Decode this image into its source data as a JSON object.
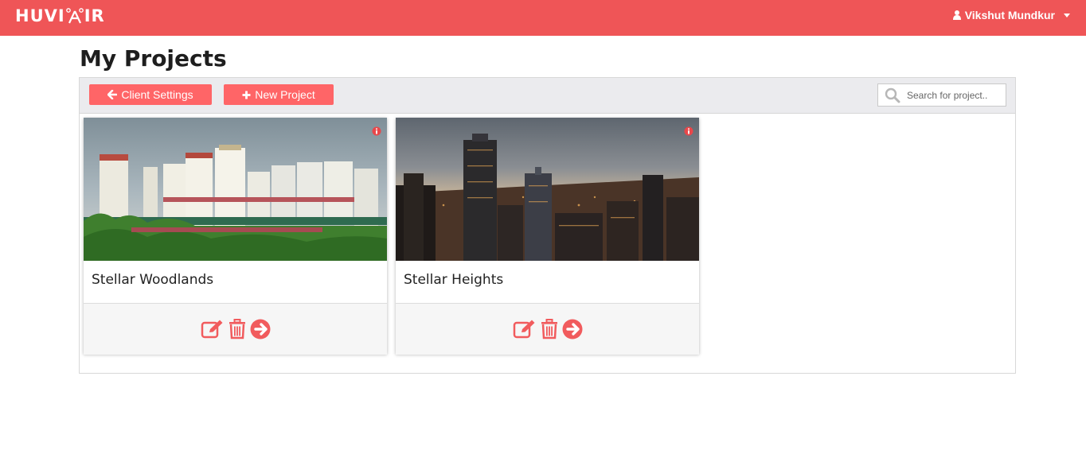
{
  "header": {
    "logo_text": "HUVIAIR",
    "user_name": "Vikshut Mundkur"
  },
  "page": {
    "title": "My Projects"
  },
  "toolbar": {
    "client_settings_label": "Client Settings",
    "new_project_label": "New Project",
    "search_placeholder": "Search for project.."
  },
  "projects": [
    {
      "name": "Stellar Woodlands"
    },
    {
      "name": "Stellar Heights"
    }
  ],
  "colors": {
    "brand": "#ef5557",
    "button": "#ff6567",
    "icon": "#f15b5d"
  },
  "icons": [
    "user-icon",
    "caret-down-icon",
    "arrow-left-icon",
    "plus-icon",
    "search-icon",
    "info-icon",
    "edit-icon",
    "trash-icon",
    "arrow-circle-right-icon"
  ]
}
